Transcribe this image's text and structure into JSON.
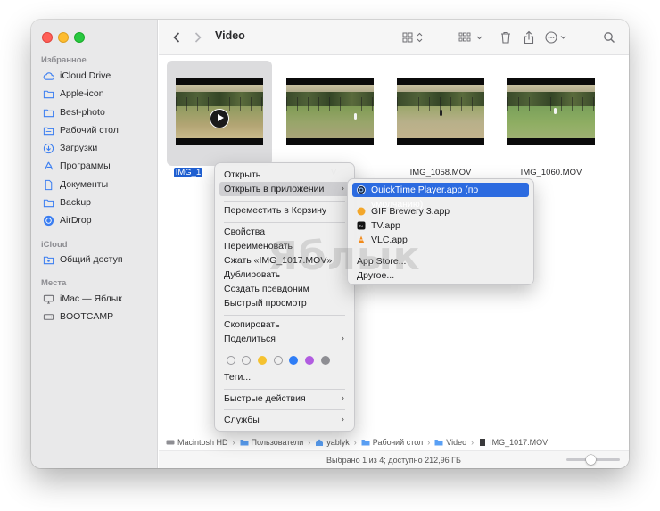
{
  "window": {
    "title": "Video"
  },
  "sidebar": {
    "favorites_header": "Избранное",
    "favorites": [
      {
        "label": "iCloud Drive",
        "icon": "cloud-icon"
      },
      {
        "label": "Apple-icon",
        "icon": "folder-icon"
      },
      {
        "label": "Best-photo",
        "icon": "folder-icon"
      },
      {
        "label": "Рабочий стол",
        "icon": "desktop-folder-icon"
      },
      {
        "label": "Загрузки",
        "icon": "download-icon"
      },
      {
        "label": "Программы",
        "icon": "apps-icon"
      },
      {
        "label": "Документы",
        "icon": "document-icon"
      },
      {
        "label": "Backup",
        "icon": "folder-icon"
      },
      {
        "label": "AirDrop",
        "icon": "airdrop-icon"
      }
    ],
    "icloud_header": "iCloud",
    "icloud": [
      {
        "label": "Общий доступ",
        "icon": "shared-folder-icon"
      }
    ],
    "locations_header": "Места",
    "locations": [
      {
        "label": "iMac — Яблык",
        "icon": "imac-icon"
      },
      {
        "label": "BOOTCAMP",
        "icon": "disk-icon"
      }
    ]
  },
  "files": [
    {
      "name": "IMG_1",
      "selected": true
    },
    {
      "name": "IMG_1017.MOV",
      "selected": false,
      "visible_name": "V"
    },
    {
      "name": "IMG_1058.MOV",
      "selected": false
    },
    {
      "name": "IMG_1060.MOV",
      "selected": false
    }
  ],
  "context_menu": {
    "items": {
      "open": "Открыть",
      "open_with": "Открыть в приложении",
      "trash": "Переместить в Корзину",
      "info": "Свойства",
      "rename": "Переименовать",
      "compress": "Сжать «IMG_1017.MOV»",
      "duplicate": "Дублировать",
      "alias": "Создать псевдоним",
      "quicklook": "Быстрый просмотр",
      "copy": "Скопировать",
      "share": "Поделиться",
      "tags": "Теги...",
      "quick_actions": "Быстрые действия",
      "services": "Службы"
    },
    "tag_colors": [
      "#ffffff",
      "#ffffff",
      "#f5c230",
      "#ffffff",
      "#2f7df6",
      "#b15ce0",
      "#8e8e93"
    ]
  },
  "submenu": {
    "default_app": "QuickTime Player.app (по умолчанию)",
    "apps": [
      {
        "label": "GIF Brewery 3.app",
        "icon": "gif-brewery-icon"
      },
      {
        "label": "TV.app",
        "icon": "apple-tv-icon"
      },
      {
        "label": "VLC.app",
        "icon": "vlc-cone-icon"
      }
    ],
    "app_store": "App Store...",
    "other": "Другое..."
  },
  "pathbar": [
    "Macintosh HD",
    "Пользователи",
    "yablyk",
    "Рабочий стол",
    "Video",
    "IMG_1017.MOV"
  ],
  "statusbar": {
    "text": "Выбрано 1 из 4; доступно 212,96 ГБ",
    "zoom_level": 0.45
  },
  "watermark": "Яблык"
}
